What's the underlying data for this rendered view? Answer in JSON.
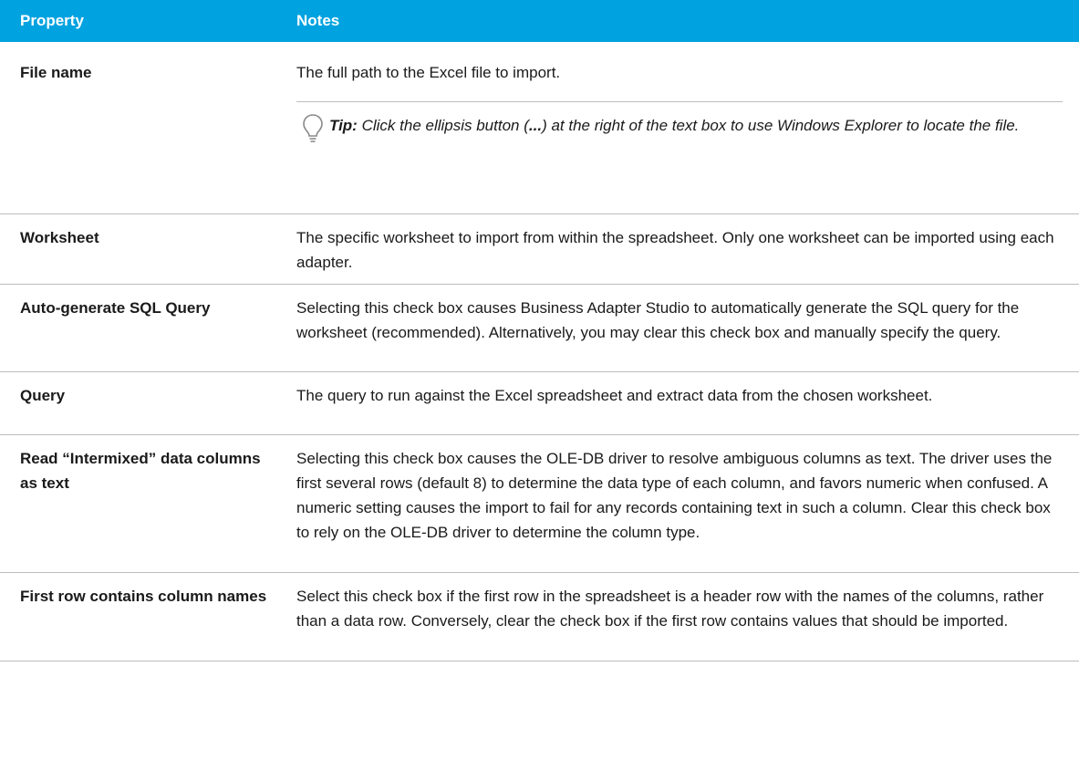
{
  "header": {
    "property": "Property",
    "notes": "Notes"
  },
  "rows": [
    {
      "property": "File name",
      "notes": "The full path to the Excel file to import."
    },
    {
      "property": "Worksheet",
      "notes": "The specific worksheet to import from within the spreadsheet. Only one worksheet can be imported using each adapter."
    },
    {
      "property": "Auto-generate SQL Query",
      "notes": "Selecting this check box causes Business Adapter Studio to automatically generate the SQL query for the worksheet (recommended). Alternatively, you may clear this check box and manually specify the query."
    },
    {
      "property": "Query",
      "notes": "The query to run against the Excel spreadsheet and extract data from the chosen worksheet."
    },
    {
      "property": "Read “Intermixed” data columns as text",
      "notes": "Selecting this check box causes the OLE-DB driver to resolve ambiguous columns as text. The driver uses the first several rows (default 8) to determine the data type of each column, and favors numeric when confused. A numeric setting causes the import to fail for any records containing text in such a column. Clear this check box to rely on the OLE-DB driver to determine the column type."
    },
    {
      "property": "First row contains column names",
      "notes": "Select this check box if the first row in the spreadsheet is a header row with the names of the columns, rather than a data row. Conversely, clear the check box if the first row contains values that should be imported."
    }
  ],
  "tip": {
    "label": "Tip:",
    "text_before": " Click the ellipsis button (",
    "ellipsis": "...",
    "text_after": ") at the right of the text box to use Windows Explorer to locate the file.",
    "icon": "lightbulb-icon"
  },
  "colors": {
    "header_bg": "#00a2e0",
    "header_text": "#ffffff",
    "rule": "#bdbdbd"
  }
}
